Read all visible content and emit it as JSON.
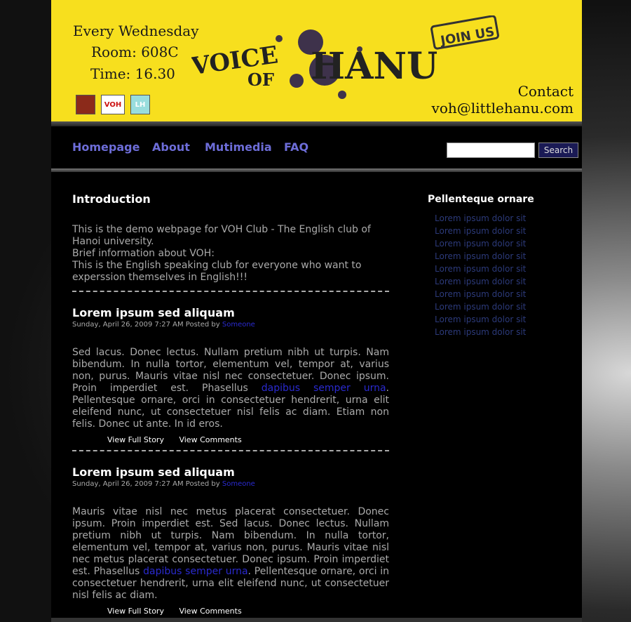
{
  "banner": {
    "line1": "Every Wednesday",
    "line2": "Room: 608C",
    "line3": "Time: 16.30",
    "title": "VOICE OF HANU",
    "join": "JOIN US",
    "contact_label": "Contact",
    "contact_email": "voh@littlehanu.com",
    "logo_voh": "VOH",
    "logo_lh": "LH"
  },
  "nav": {
    "items": [
      "Homepage",
      "About",
      "Mutimedia",
      "FAQ"
    ],
    "search_value": "",
    "search_button": "Search"
  },
  "intro": {
    "title": "Introduction",
    "text1": "This is the demo webpage for VOH Club - The English club of Hanoi university.",
    "text2": "Brief information about VOH:",
    "text3": "This is the English speaking club for everyone who want to experssion themselves in English!!!"
  },
  "posts": [
    {
      "title": "Lorem ipsum sed aliquam",
      "date": "Sunday, April 26, 2009 7:27 AM Posted by",
      "author": "Someone",
      "body_before": "Sed lacus. Donec lectus. Nullam pretium nibh ut turpis. Nam bibendum. In nulla tortor, elementum vel, tempor at, varius non, purus. Mauris vitae nisl nec consectetuer. Donec ipsum. Proin imperdiet est. Phasellus ",
      "link": "dapibus semper urna",
      "body_after": ". Pellentesque ornare, orci in consectetuer hendrerit, urna elit eleifend nunc, ut consectetuer nisl felis ac diam. Etiam non felis. Donec ut ante. In id eros.",
      "full_story": "View Full Story",
      "comments": "View Comments"
    },
    {
      "title": "Lorem ipsum sed aliquam",
      "date": "Sunday, April 26, 2009 7:27 AM Posted by",
      "author": "Someone",
      "body_before": "Mauris vitae nisl nec metus placerat consectetuer. Donec ipsum. Proin imperdiet est. Sed lacus. Donec lectus. Nullam pretium nibh ut turpis. Nam bibendum. In nulla tortor, elementum vel, tempor at, varius non, purus. Mauris vitae nisl nec metus placerat consectetuer. Donec ipsum. Proin imperdiet est. Phasellus ",
      "link": "dapibus semper urna",
      "body_after": ". Pellentesque ornare, orci in consectetuer hendrerit, urna elit eleifend nunc, ut consectetuer nisl felis ac diam.",
      "full_story": "View Full Story",
      "comments": "View Comments"
    }
  ],
  "sidebar": {
    "title": "Pellenteque ornare",
    "items": [
      "Lorem ipsum dolor sit",
      "Lorem ipsum dolor sit",
      "Lorem ipsum dolor sit",
      "Lorem ipsum dolor sit",
      "Lorem ipsum dolor sit",
      "Lorem ipsum dolor sit",
      "Lorem ipsum dolor sit",
      "Lorem ipsum dolor sit",
      "Lorem ipsum dolor sit",
      "Lorem ipsum dolor sit"
    ]
  },
  "colors": {
    "banner": "#f7df1e",
    "nav_link": "#6d6dd8",
    "link": "#2a2ad0",
    "sidebar_link": "#2c3a7a"
  }
}
